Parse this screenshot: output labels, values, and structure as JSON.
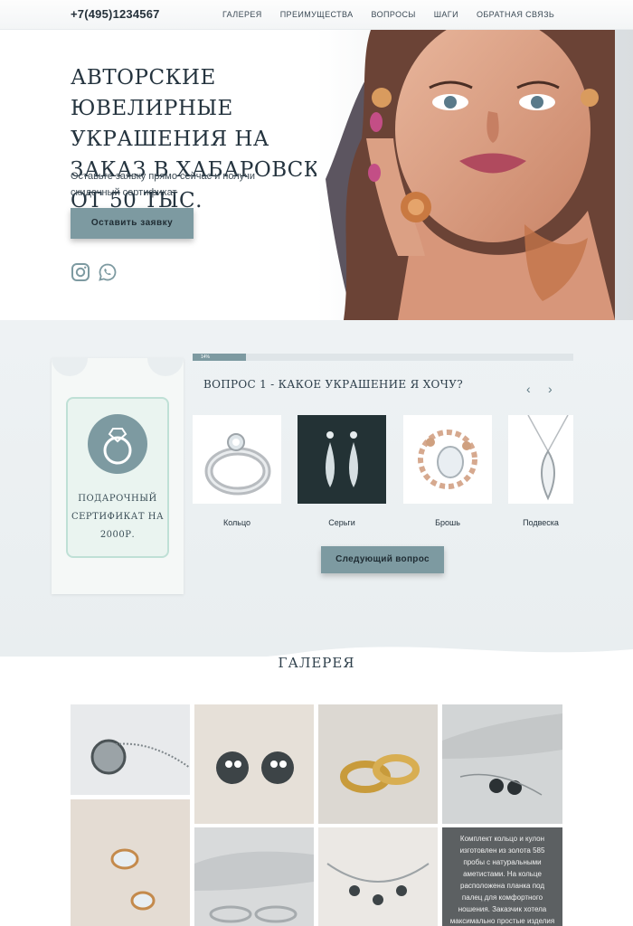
{
  "header": {
    "phone": "+7(495)1234567",
    "nav": [
      "ГАЛЕРЕЯ",
      "ПРЕИМУЩЕСТВА",
      "ВОПРОСЫ",
      "ШАГИ",
      "ОБРАТНАЯ СВЯЗЬ"
    ]
  },
  "hero": {
    "title": "АВТОРСКИЕ ЮВЕЛИРНЫЕ УКРАШЕНИЯ НА ЗАКАЗ В ХАБАРОВСКЕ ОТ 50 ТЫС.",
    "subtitle": "Оставьте заявку прямо сейчас и получи скидочный сертификат",
    "cta": "Оставить заявку",
    "social_icons": [
      "instagram-icon",
      "whatsapp-icon"
    ]
  },
  "certificate": {
    "text": "ПОДАРОЧНЫЙ СЕРТИФИКАТ НА 2000Р."
  },
  "quiz": {
    "progress_label": "14%",
    "progress_fraction": 0.14,
    "question": "ВОПРОС 1 - КАКОЕ УКРАШЕНИЕ Я ХОЧУ?",
    "prev": "‹",
    "next_arrow": "›",
    "options": [
      {
        "label": "Кольцо",
        "icon": "ring"
      },
      {
        "label": "Серьги",
        "icon": "earrings"
      },
      {
        "label": "Брошь",
        "icon": "brooch"
      },
      {
        "label": "Подвеска",
        "icon": "pendant"
      }
    ],
    "next_button": "Следующий вопрос"
  },
  "gallery": {
    "title": "ГАЛЕРЕЯ",
    "caption": "Комплект кольцо и кулон изготовлен из золота 585 пробы с натуральными аметистами. На кольце расположена планка под палец для комфортного ношения. Заказчик хотела максимально простые изделия \"только камень и полоска"
  },
  "colors": {
    "accent": "#7d9aa1",
    "text": "#2d3e4a",
    "section_bg": "#eef2f4",
    "cert_border": "#bfe0d6"
  }
}
